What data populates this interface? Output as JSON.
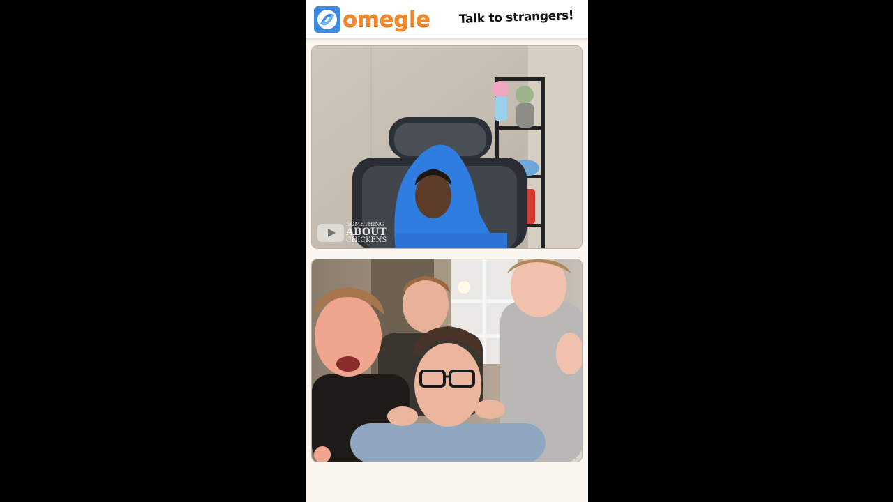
{
  "app": {
    "logo_text": "omegle",
    "tagline": "Talk to strangers!"
  },
  "stranger_video": {
    "watermark": {
      "line1": "SOMETHING",
      "line2": "ABOUT",
      "line3": "CHICKENS"
    }
  },
  "colors": {
    "logo_orange": "#f08a2c",
    "logo_blue": "#3a8be0",
    "background": "#fbf6ef",
    "letterbox": "#000000"
  },
  "icons": [
    "omegle-logo-icon",
    "youtube-icon"
  ]
}
